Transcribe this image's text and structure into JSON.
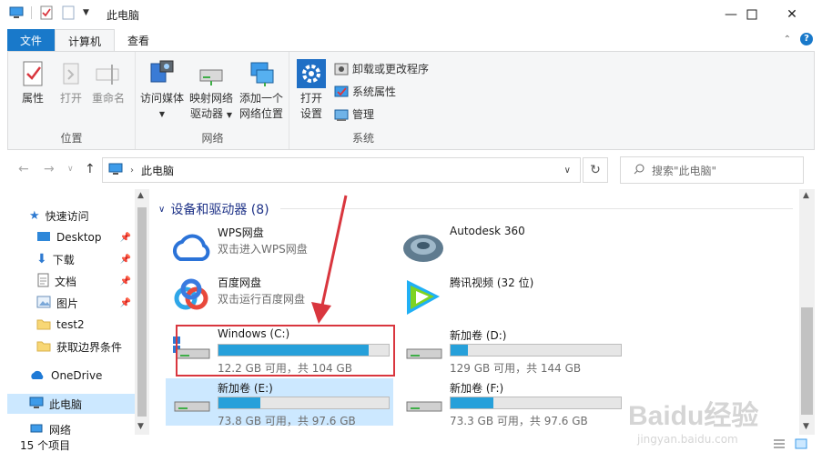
{
  "window": {
    "title": "此电脑",
    "minimize_icon": "minimize-icon",
    "maximize_icon": "maximize-icon",
    "close_icon": "close-icon"
  },
  "ribbon_tabs": [
    {
      "label": "文件"
    },
    {
      "label": "计算机"
    },
    {
      "label": "查看"
    }
  ],
  "ribbon": {
    "groups": {
      "location": {
        "label": "位置",
        "buttons": [
          {
            "label": "属性",
            "icon": "properties-icon"
          },
          {
            "label": "打开",
            "icon": "open-icon"
          },
          {
            "label": "重命名",
            "icon": "rename-icon"
          }
        ]
      },
      "network": {
        "label": "网络",
        "buttons": [
          {
            "label1": "访问媒体",
            "label2": "",
            "icon": "media-icon"
          },
          {
            "label1": "映射网络",
            "label2": "驱动器",
            "icon": "map-drive-icon"
          },
          {
            "label1": "添加一个",
            "label2": "网络位置",
            "icon": "network-location-icon"
          }
        ]
      },
      "system": {
        "label": "系统",
        "open_settings": {
          "label1": "打开",
          "label2": "设置",
          "icon": "gear-icon"
        },
        "small": [
          {
            "label": "卸载或更改程序",
            "icon": "uninstall-icon"
          },
          {
            "label": "系统属性",
            "icon": "system-properties-icon"
          },
          {
            "label": "管理",
            "icon": "manage-icon"
          }
        ]
      }
    }
  },
  "address_bar": {
    "path": "此电脑",
    "search_placeholder": "搜索\"此电脑\""
  },
  "nav_pane": {
    "items": [
      {
        "label": "快速访问",
        "icon": "star-icon"
      },
      {
        "label": "Desktop",
        "icon": "desktop-icon"
      },
      {
        "label": "下载",
        "icon": "download-icon"
      },
      {
        "label": "文档",
        "icon": "document-icon"
      },
      {
        "label": "图片",
        "icon": "picture-icon"
      },
      {
        "label": "test2",
        "icon": "folder-icon"
      },
      {
        "label": "获取边界条件",
        "icon": "folder-icon"
      },
      {
        "label": "OneDrive",
        "icon": "cloud-icon"
      },
      {
        "label": "此电脑",
        "icon": "computer-icon"
      },
      {
        "label": "网络",
        "icon": "network-icon"
      }
    ]
  },
  "section": {
    "title": "设备和驱动器 (8)"
  },
  "devices": [
    {
      "name": "WPS网盘",
      "sub": "双击进入WPS网盘",
      "icon": "wps-cloud-icon"
    },
    {
      "name": "Autodesk 360",
      "sub": "",
      "icon": "autodesk-icon"
    },
    {
      "name": "百度网盘",
      "sub": "双击运行百度网盘",
      "icon": "baidu-netdisk-icon"
    },
    {
      "name": "腾讯视频 (32 位)",
      "sub": "",
      "icon": "tencent-video-icon"
    }
  ],
  "drives": [
    {
      "name": "Windows (C:)",
      "free": "12.2 GB 可用，共 104 GB",
      "used_fraction": 0.883,
      "icon": "windows-drive-icon"
    },
    {
      "name": "新加卷 (D:)",
      "free": "129 GB 可用，共 144 GB",
      "used_fraction": 0.104,
      "icon": "hard-drive-icon"
    },
    {
      "name": "新加卷 (E:)",
      "free": "73.8 GB 可用，共 97.6 GB",
      "used_fraction": 0.244,
      "icon": "hard-drive-icon"
    },
    {
      "name": "新加卷 (F:)",
      "free": "73.3 GB 可用，共 97.6 GB",
      "used_fraction": 0.249,
      "icon": "hard-drive-icon"
    }
  ],
  "status_bar": {
    "count": "15 个项目"
  },
  "watermark": {
    "text": "Baidu经验",
    "url": "jingyan.baidu.com"
  },
  "colors": {
    "accent": "#1979ca",
    "drive_fill": "#26a0da",
    "annotation": "#d9363e"
  }
}
